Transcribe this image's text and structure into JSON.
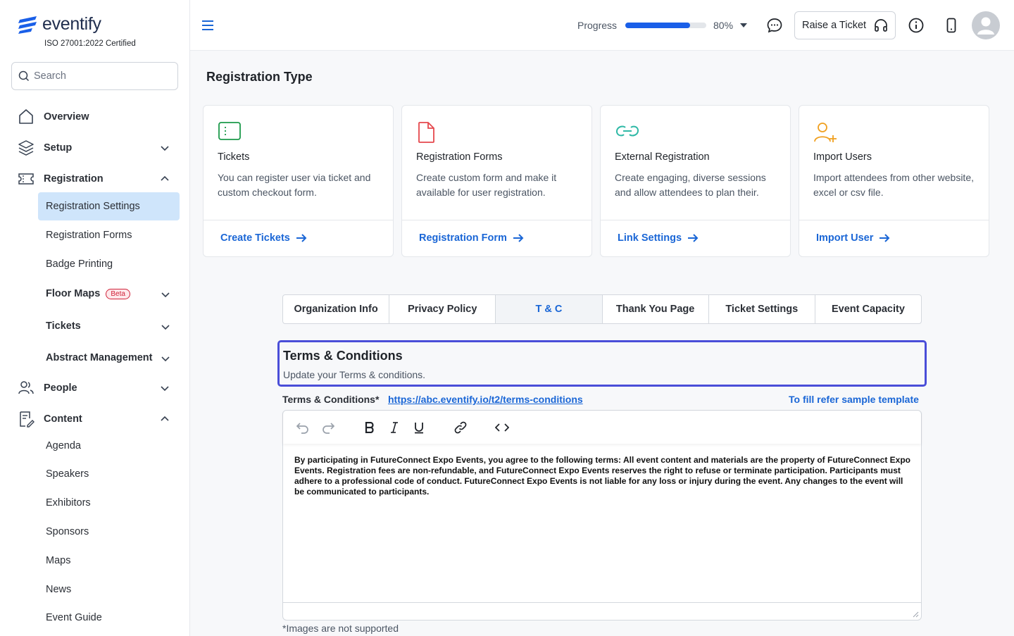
{
  "brand": {
    "name": "eventify",
    "certification": "ISO 27001:2022 Certified"
  },
  "search": {
    "placeholder": "Search"
  },
  "sidebar": {
    "items": [
      {
        "label": "Overview"
      },
      {
        "label": "Setup"
      },
      {
        "label": "Registration"
      },
      {
        "label": "People"
      },
      {
        "label": "Content"
      }
    ],
    "registration_sub": [
      {
        "label": "Registration Settings"
      },
      {
        "label": "Registration Forms"
      },
      {
        "label": "Badge Printing"
      },
      {
        "label": "Floor Maps",
        "badge": "Beta"
      },
      {
        "label": "Tickets"
      },
      {
        "label": "Abstract Management"
      }
    ],
    "content_sub": [
      {
        "label": "Agenda"
      },
      {
        "label": "Speakers"
      },
      {
        "label": "Exhibitors"
      },
      {
        "label": "Sponsors"
      },
      {
        "label": "Maps"
      },
      {
        "label": "News"
      },
      {
        "label": "Event Guide"
      }
    ]
  },
  "header": {
    "progress_label": "Progress",
    "progress_value": 0.8,
    "progress_text": "80%",
    "ticket_button": "Raise a Ticket"
  },
  "main": {
    "section_title": "Registration Type",
    "cards": [
      {
        "title": "Tickets",
        "desc": "You can register user via ticket and custom checkout form.",
        "link": "Create Tickets"
      },
      {
        "title": "Registration Forms",
        "desc": "Create custom form and make it available for user registration.",
        "link": "Registration Form"
      },
      {
        "title": "External Registration",
        "desc": "Create engaging, diverse sessions and allow attendees to plan their.",
        "link": "Link Settings"
      },
      {
        "title": "Import Users",
        "desc": "Import attendees from other website, excel or csv file.",
        "link": "Import User"
      }
    ],
    "tabs": [
      {
        "label": "Organization Info"
      },
      {
        "label": "Privacy Policy"
      },
      {
        "label": "T & C",
        "active": true
      },
      {
        "label": "Thank You Page"
      },
      {
        "label": "Ticket Settings"
      },
      {
        "label": "Event Capacity"
      }
    ],
    "tc": {
      "title": "Terms & Conditions",
      "subtitle": "Update your Terms & conditions.",
      "field_label": "Terms & Conditions*",
      "field_link": "https://abc.eventify.io/t2/terms-conditions",
      "sample_link": "To fill refer sample template",
      "content": "By participating in FutureConnect Expo Events, you agree to the following terms: All event content and materials are the property of FutureConnect Expo Events. Registration fees are non-refundable, and FutureConnect Expo Events reserves the right to refuse or terminate participation. Participants must adhere to a professional code of conduct. FutureConnect Expo Events is not liable for any loss or injury during the event. Any changes to the event will be communicated to participants.",
      "note": "*Images are not supported"
    }
  },
  "colors": {
    "accent": "#1a66d6",
    "active_bg": "#cfe5fb",
    "focus_border": "#4a4ed8",
    "progress": "#1a5fe8"
  }
}
